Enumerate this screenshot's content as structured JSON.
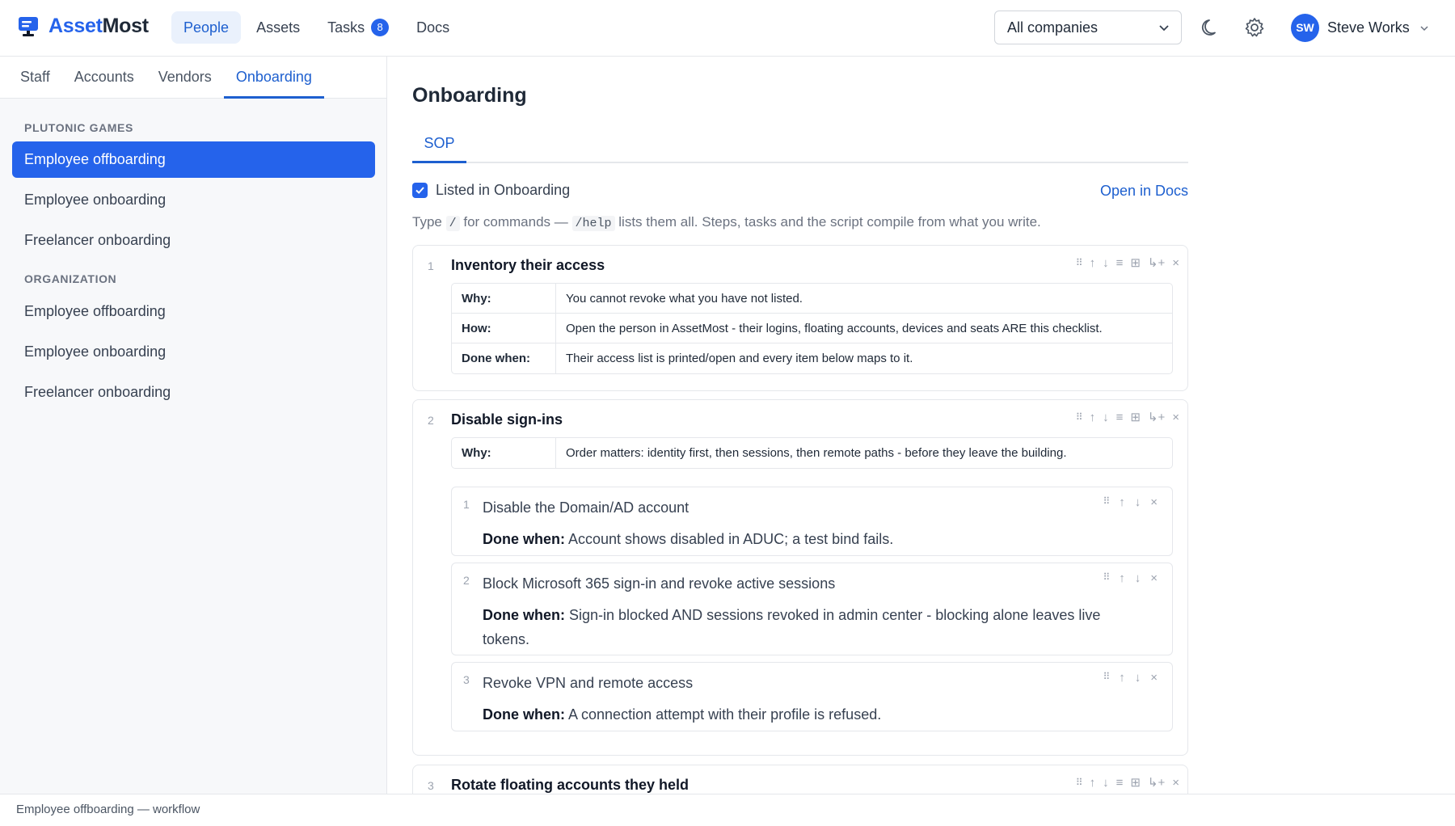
{
  "brand": {
    "name_part1": "Asset",
    "name_part2": "Most"
  },
  "nav": {
    "items": [
      {
        "label": "People"
      },
      {
        "label": "Assets"
      },
      {
        "label": "Tasks",
        "badge": "8"
      },
      {
        "label": "Docs"
      }
    ]
  },
  "company_filter": {
    "value": "All companies"
  },
  "user": {
    "initials": "SW",
    "name": "Steve Works"
  },
  "subtabs": [
    "Staff",
    "Accounts",
    "Vendors",
    "Onboarding"
  ],
  "sidebar": {
    "groups": [
      {
        "title": "PLUTONIC GAMES",
        "items": [
          "Employee offboarding",
          "Employee onboarding",
          "Freelancer onboarding"
        ]
      },
      {
        "title": "ORGANIZATION",
        "items": [
          "Employee offboarding",
          "Employee onboarding",
          "Freelancer onboarding"
        ]
      }
    ]
  },
  "main": {
    "title": "Onboarding",
    "tab": "SOP",
    "listed_label": "Listed in Onboarding",
    "open_docs": "Open in Docs",
    "hint": {
      "p1": "Type",
      "code1": "/",
      "p2": "for commands —",
      "code2": "/help",
      "p3": "lists them all. Steps, tasks and the script compile from what you write."
    },
    "steps": [
      {
        "num": "1",
        "title": "Inventory their access",
        "rows": [
          {
            "k": "Why:",
            "v": "You cannot revoke what you have not listed."
          },
          {
            "k": "How:",
            "v": "Open the person in AssetMost - their logins, floating accounts, devices and seats ARE this checklist."
          },
          {
            "k": "Done when:",
            "v": "Their access list is printed/open and every item below maps to it."
          }
        ]
      },
      {
        "num": "2",
        "title": "Disable sign-ins",
        "rows": [
          {
            "k": "Why:",
            "v": "Order matters: identity first, then sessions, then remote paths - before they leave the building."
          }
        ],
        "tasks": [
          {
            "num": "1",
            "title": "Disable the Domain/AD account",
            "done_label": "Done when:",
            "done": "Account shows disabled in ADUC; a test bind fails."
          },
          {
            "num": "2",
            "title": "Block Microsoft 365 sign-in and revoke active sessions",
            "done_label": "Done when:",
            "done": "Sign-in blocked AND sessions revoked in admin center - blocking alone leaves live tokens."
          },
          {
            "num": "3",
            "title": "Revoke VPN and remote access",
            "done_label": "Done when:",
            "done": "A connection attempt with their profile is refused."
          }
        ]
      },
      {
        "num": "3",
        "title": "Rotate floating accounts they held"
      }
    ]
  },
  "tools": {
    "grip": "⠿",
    "up": "↑",
    "down": "↓",
    "list": "≡",
    "table": "⊞",
    "subtask": "↳+",
    "remove": "×"
  },
  "status": "Employee offboarding — workflow",
  "colors": {
    "accent": "#2563eb",
    "link": "#1d5fcf"
  }
}
